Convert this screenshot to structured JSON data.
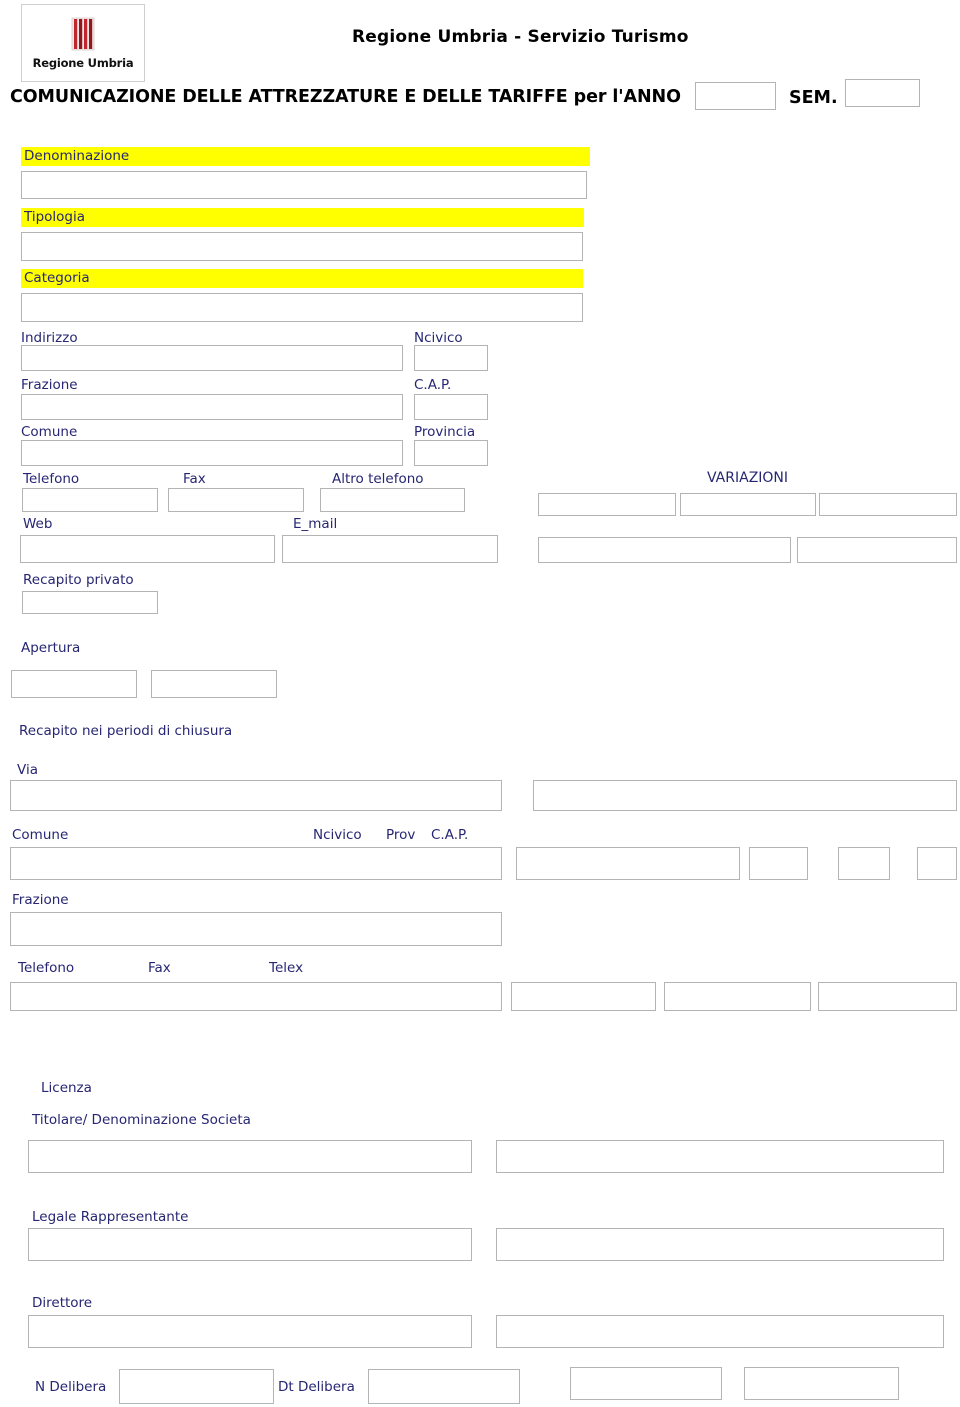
{
  "header": {
    "logo_alt": "Regione Umbria",
    "logo_caption": "Regione Umbria",
    "org_title": "Regione Umbria - Servizio Turismo",
    "doc_title": "COMUNICAZIONE DELLE ATTREZZATURE E DELLE TARIFFE per l'ANNO",
    "sem_label": "SEM.",
    "anno_value": "",
    "sem_value": ""
  },
  "identity": {
    "denominazione_label": "Denominazione",
    "denominazione_value": "",
    "tipologia_label": "Tipologia",
    "tipologia_value": "",
    "categoria_label": "Categoria",
    "categoria_value": ""
  },
  "address": {
    "indirizzo_label": "Indirizzo",
    "indirizzo_value": "",
    "ncivico_label": "Ncivico",
    "ncivico_value": "",
    "frazione_label": "Frazione",
    "frazione_value": "",
    "cap_label": "C.A.P.",
    "cap_value": "",
    "comune_label": "Comune",
    "comune_value": "",
    "provincia_label": "Provincia",
    "provincia_value": ""
  },
  "contacts": {
    "telefono_label": "Telefono",
    "telefono_value": "",
    "fax_label": "Fax",
    "fax_value": "",
    "altro_telefono_label": "Altro telefono",
    "altro_telefono_value": "",
    "web_label": "Web",
    "web_value": "",
    "email_label": "E_mail",
    "email_value": "",
    "recapito_privato_label": "Recapito privato",
    "recapito_privato_value": ""
  },
  "variazioni": {
    "title": "VARIAZIONI",
    "row1": [
      "",
      "",
      ""
    ],
    "row2": [
      "",
      ""
    ]
  },
  "apertura": {
    "label": "Apertura",
    "values": [
      "",
      ""
    ]
  },
  "chiusura": {
    "section_label": "Recapito nei periodi di chiusura",
    "via_label": "Via",
    "via_value": "",
    "via_extra_value": "",
    "comune_label": "Comune",
    "comune_value": "",
    "ncivico_label": "Ncivico",
    "ncivico_value": "",
    "prov_label": "Prov",
    "prov_value": "",
    "cap_label": "C.A.P.",
    "cap_value": "",
    "comune_extra_value": "",
    "frazione_label": "Frazione",
    "frazione_value": "",
    "telefono_label": "Telefono",
    "telefono_value": "",
    "fax_label": "Fax",
    "fax_value": "",
    "telex_label": "Telex",
    "telex_value": "",
    "telex_extra_value": ""
  },
  "licenza": {
    "licenza_label": "Licenza",
    "titolare_label": "Titolare/ Denominazione Societa",
    "titolare_value": "",
    "titolare_extra_value": "",
    "legale_label": "Legale Rappresentante",
    "legale_value": "",
    "legale_extra_value": "",
    "direttore_label": "Direttore",
    "direttore_value": "",
    "direttore_extra_value": "",
    "n_delibera_label": "N Delibera",
    "n_delibera_value": "",
    "dt_delibera_label": "Dt Delibera",
    "dt_delibera_value": "",
    "delibera_extra1": "",
    "delibera_extra2": ""
  },
  "colors": {
    "label_navy": "#262673",
    "highlight_yellow": "#ffff00",
    "box_border": "#b4b4b4",
    "logo_red": "#c1272d"
  }
}
